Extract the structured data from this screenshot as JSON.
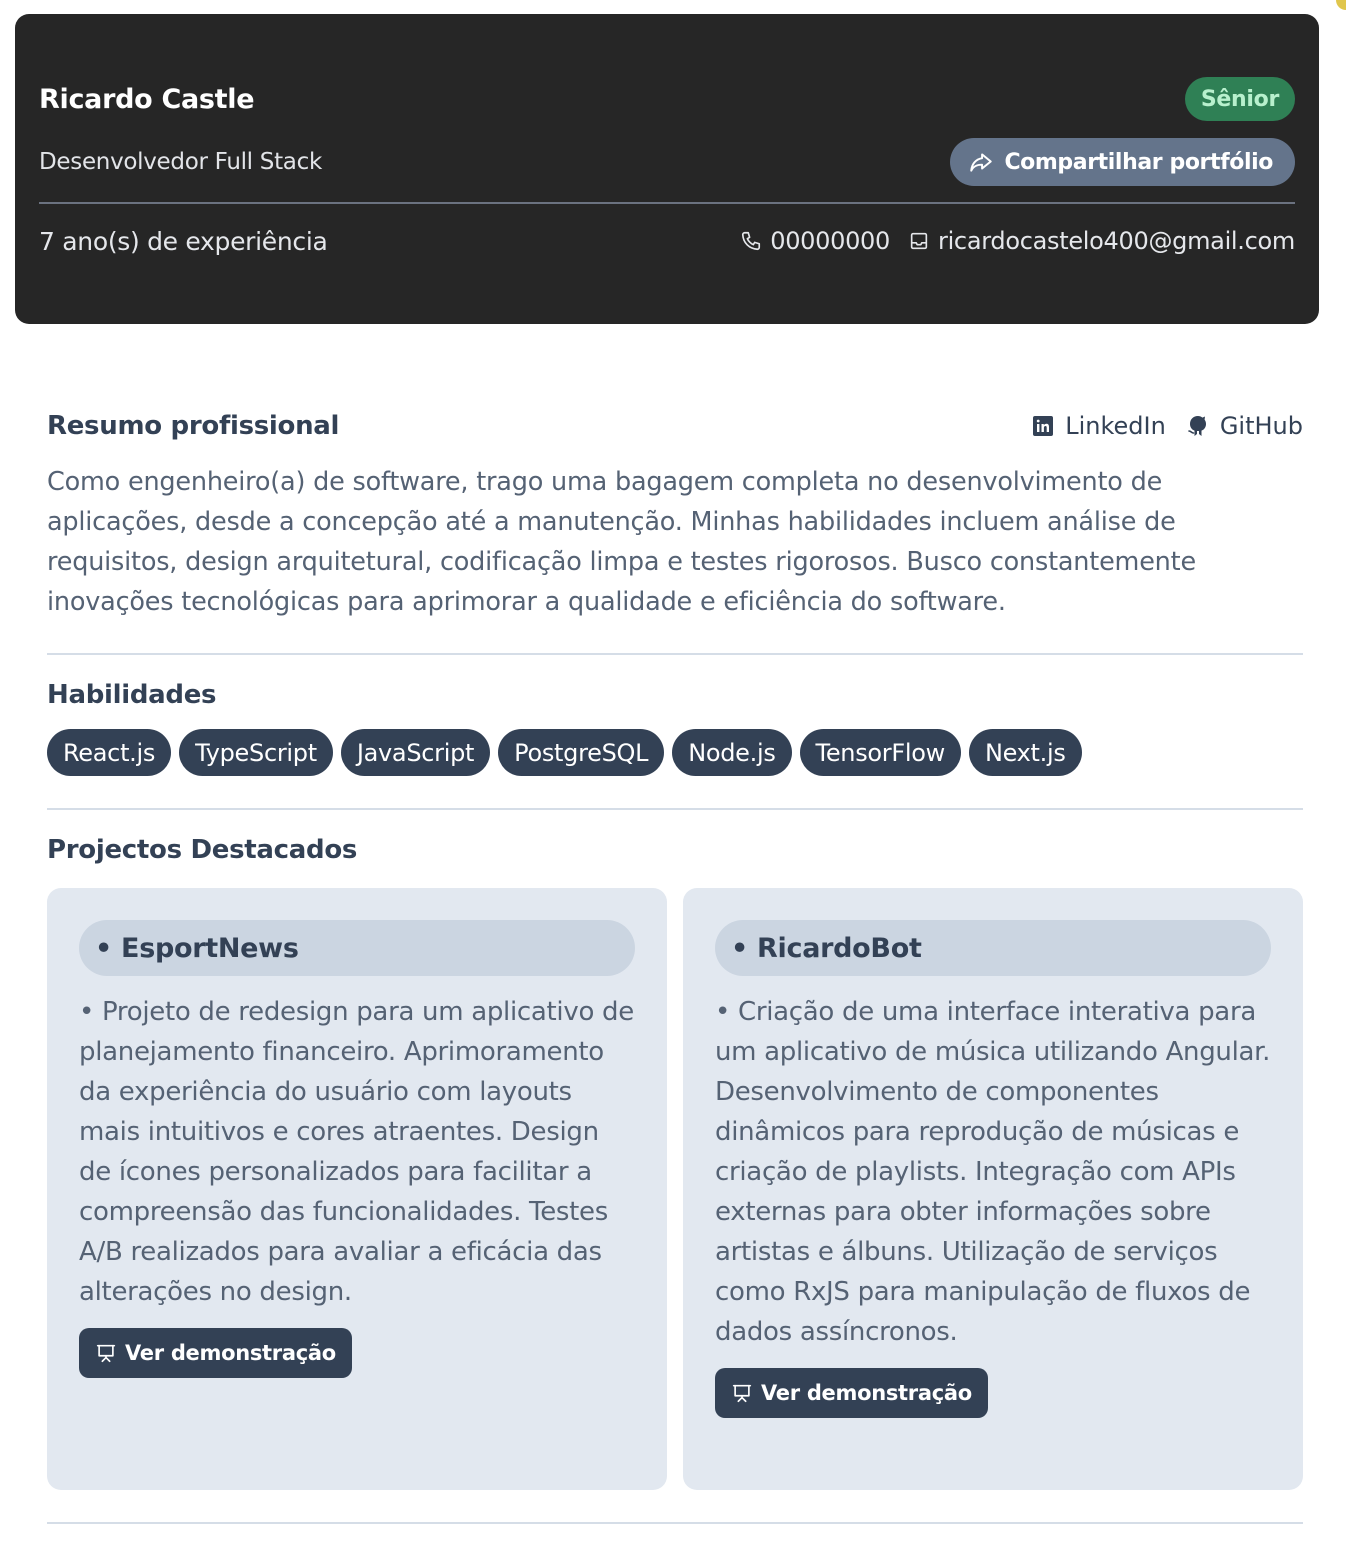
{
  "header": {
    "name": "Ricardo Castle",
    "level_badge": "Sênior",
    "role": "Desenvolvedor Full Stack",
    "share_label": "Compartilhar portfólio",
    "experience": "7 ano(s) de experiência",
    "phone": "00000000",
    "email": "ricardocastelo400@gmail.com",
    "icons": {
      "share": "share-arrow-icon",
      "phone": "phone-icon",
      "email": "inbox-icon"
    }
  },
  "summary": {
    "title": "Resumo profissional",
    "links": [
      {
        "label": "LinkedIn",
        "icon": "linkedin-icon"
      },
      {
        "label": "GitHub",
        "icon": "github-icon"
      }
    ],
    "text": "Como engenheiro(a) de software, trago uma bagagem completa no desenvolvimento de aplicações, desde a concepção até a manutenção. Minhas habilidades incluem análise de requisitos, design arquitetural, codificação limpa e testes rigorosos. Busco constantemente inovações tecnológicas para aprimorar a qualidade e eficiência do software."
  },
  "skills": {
    "title": "Habilidades",
    "items": [
      "React.js",
      "TypeScript",
      "JavaScript",
      "PostgreSQL",
      "Node.js",
      "TensorFlow",
      "Next.js"
    ]
  },
  "projects": {
    "title": "Projectos Destacados",
    "items": [
      {
        "title": "• EsportNews",
        "description": "• Projeto de redesign para um aplicativo de planejamento financeiro. Aprimoramento da experiência do usuário com layouts mais intuitivos e cores atraentes. Design de ícones personalizados para facilitar a compreensão das funcionalidades. Testes A/B realizados para avaliar a eficácia das alterações no design.",
        "button": "Ver demonstração"
      },
      {
        "title": "• RicardoBot",
        "description": "• Criação de uma interface interativa para um aplicativo de música utilizando Angular. Desenvolvimento de componentes dinâmicos para reprodução de músicas e criação de playlists. Integração com APIs externas para obter informações sobre artistas e álbuns. Utilização de serviços como RxJS para manipulação de fluxos de dados assíncronos.",
        "button": "Ver demonstração"
      }
    ]
  },
  "colors": {
    "header_bg": "#262626",
    "badge_bg": "#2f8055",
    "badge_text": "#b8f0cd",
    "share_bg": "#64748b",
    "chip_bg": "#334155",
    "card_bg": "#e2e8f0",
    "card_title_bg": "#cbd5e1"
  }
}
